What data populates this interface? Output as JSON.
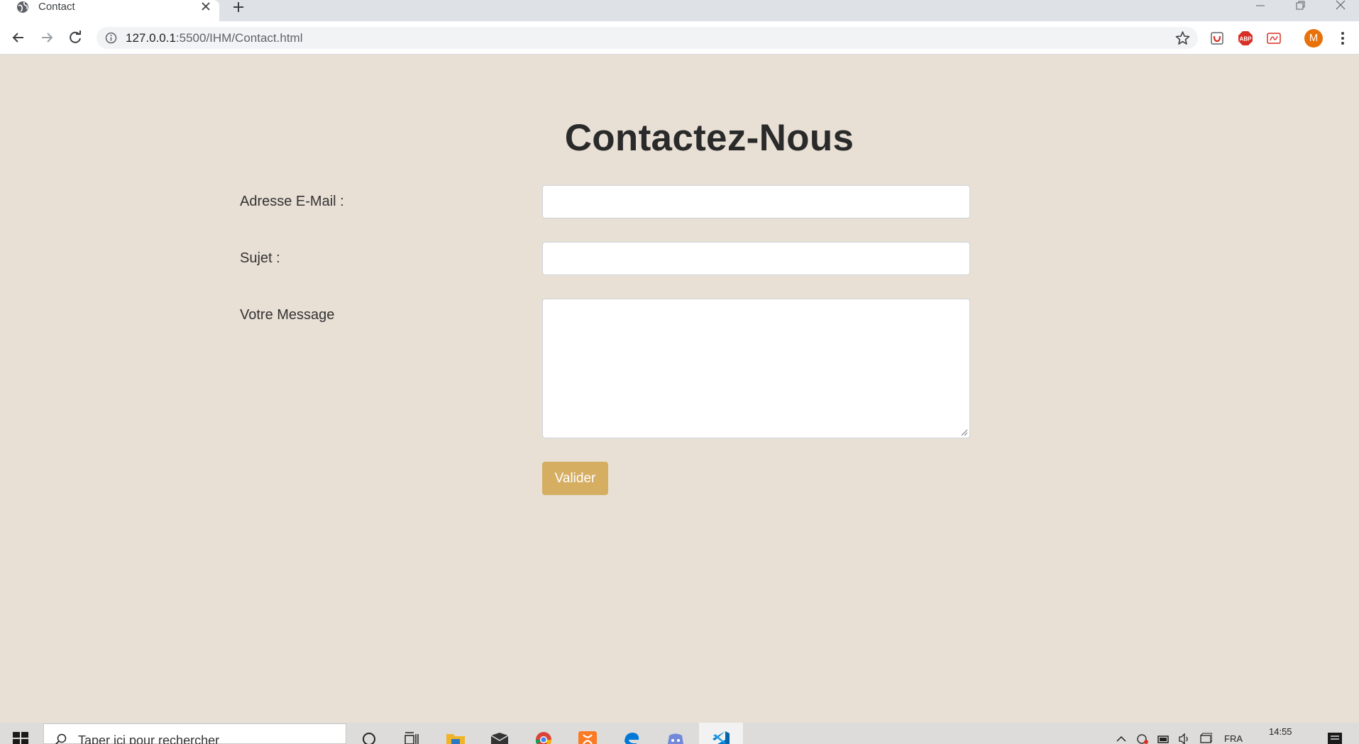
{
  "browser": {
    "tab_title": "Contact",
    "url_host": "127.0.0.1",
    "url_rest": ":5500/IHM/Contact.html",
    "avatar_initial": "M",
    "extensions": [
      "pocket-icon",
      "adblock-plus-icon",
      "pdf-icon"
    ]
  },
  "page": {
    "title": "Contactez-Nous",
    "email_label": "Adresse E-Mail :",
    "email_value": "",
    "subject_label": "Sujet :",
    "subject_value": "",
    "message_label": "Votre Message",
    "message_value": "",
    "submit_label": "Valider"
  },
  "taskbar": {
    "search_placeholder": "Taper ici pour rechercher",
    "apps": [
      "cortana-icon",
      "task-view-icon",
      "file-explorer-icon",
      "mail-icon",
      "chrome-icon",
      "xampp-icon",
      "edge-icon",
      "discord-icon",
      "vscode-icon"
    ],
    "language": "FRA",
    "time": "14:55"
  },
  "colors": {
    "page_background": "#e8dfd5",
    "button_background": "#d5ae62",
    "avatar_background": "#e8710a"
  }
}
